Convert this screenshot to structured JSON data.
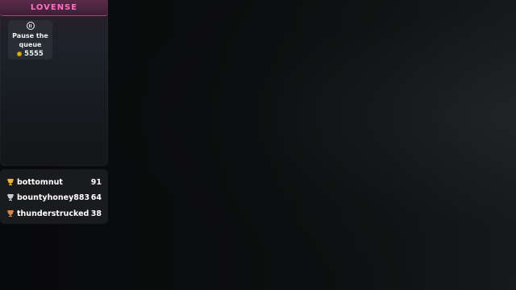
{
  "lovense": {
    "logo_text": "LOVENSE",
    "queue_card": {
      "label": "Pause the queue",
      "price": "5555",
      "icon": "pause-circle-icon",
      "coin_icon": "token-coin-icon"
    }
  },
  "leaderboard": {
    "rows": [
      {
        "name": "bottomnut",
        "score": "91",
        "icon": "trophy-icon",
        "trophy_color": "#e8b23c"
      },
      {
        "name": "bountyhoney883",
        "score": "64",
        "icon": "trophy-icon",
        "trophy_color": "#c9c9d2"
      },
      {
        "name": "thunderstrucked",
        "score": "38",
        "icon": "trophy-icon",
        "trophy_color": "#d8864a"
      }
    ]
  },
  "colors": {
    "brand_pink": "#ff6fc4",
    "coin_gold": "#d7b21c"
  }
}
